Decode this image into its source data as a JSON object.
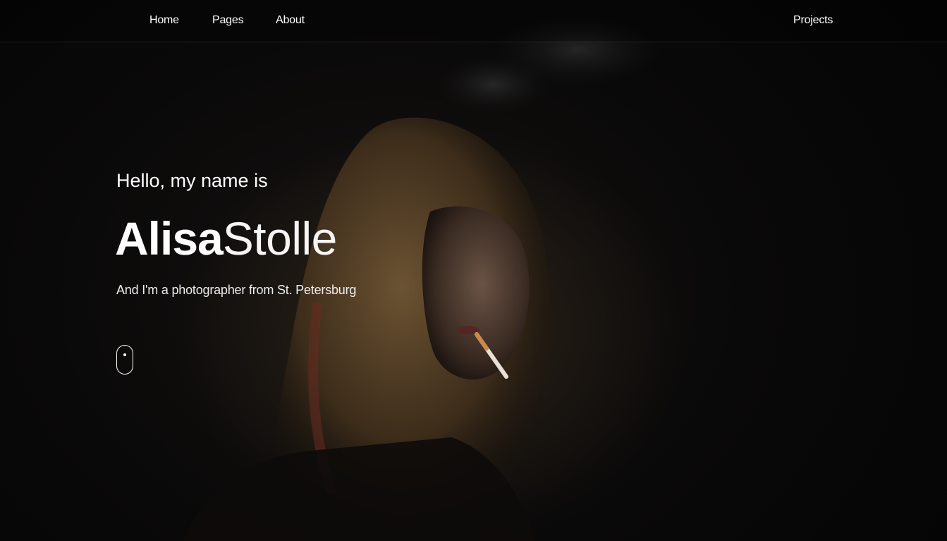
{
  "nav": {
    "items": [
      {
        "label": "Home"
      },
      {
        "label": "Pages"
      },
      {
        "label": "About"
      }
    ],
    "right_item": {
      "label": "Projects"
    }
  },
  "hero": {
    "greeting": "Hello, my name is",
    "first_name": "Alisa",
    "last_name": "Stolle",
    "tagline": "And I'm a photographer from St. Petersburg"
  },
  "icons": {
    "scroll": "mouse-scroll-icon"
  },
  "colors": {
    "background": "#070707",
    "text": "#ffffff"
  }
}
